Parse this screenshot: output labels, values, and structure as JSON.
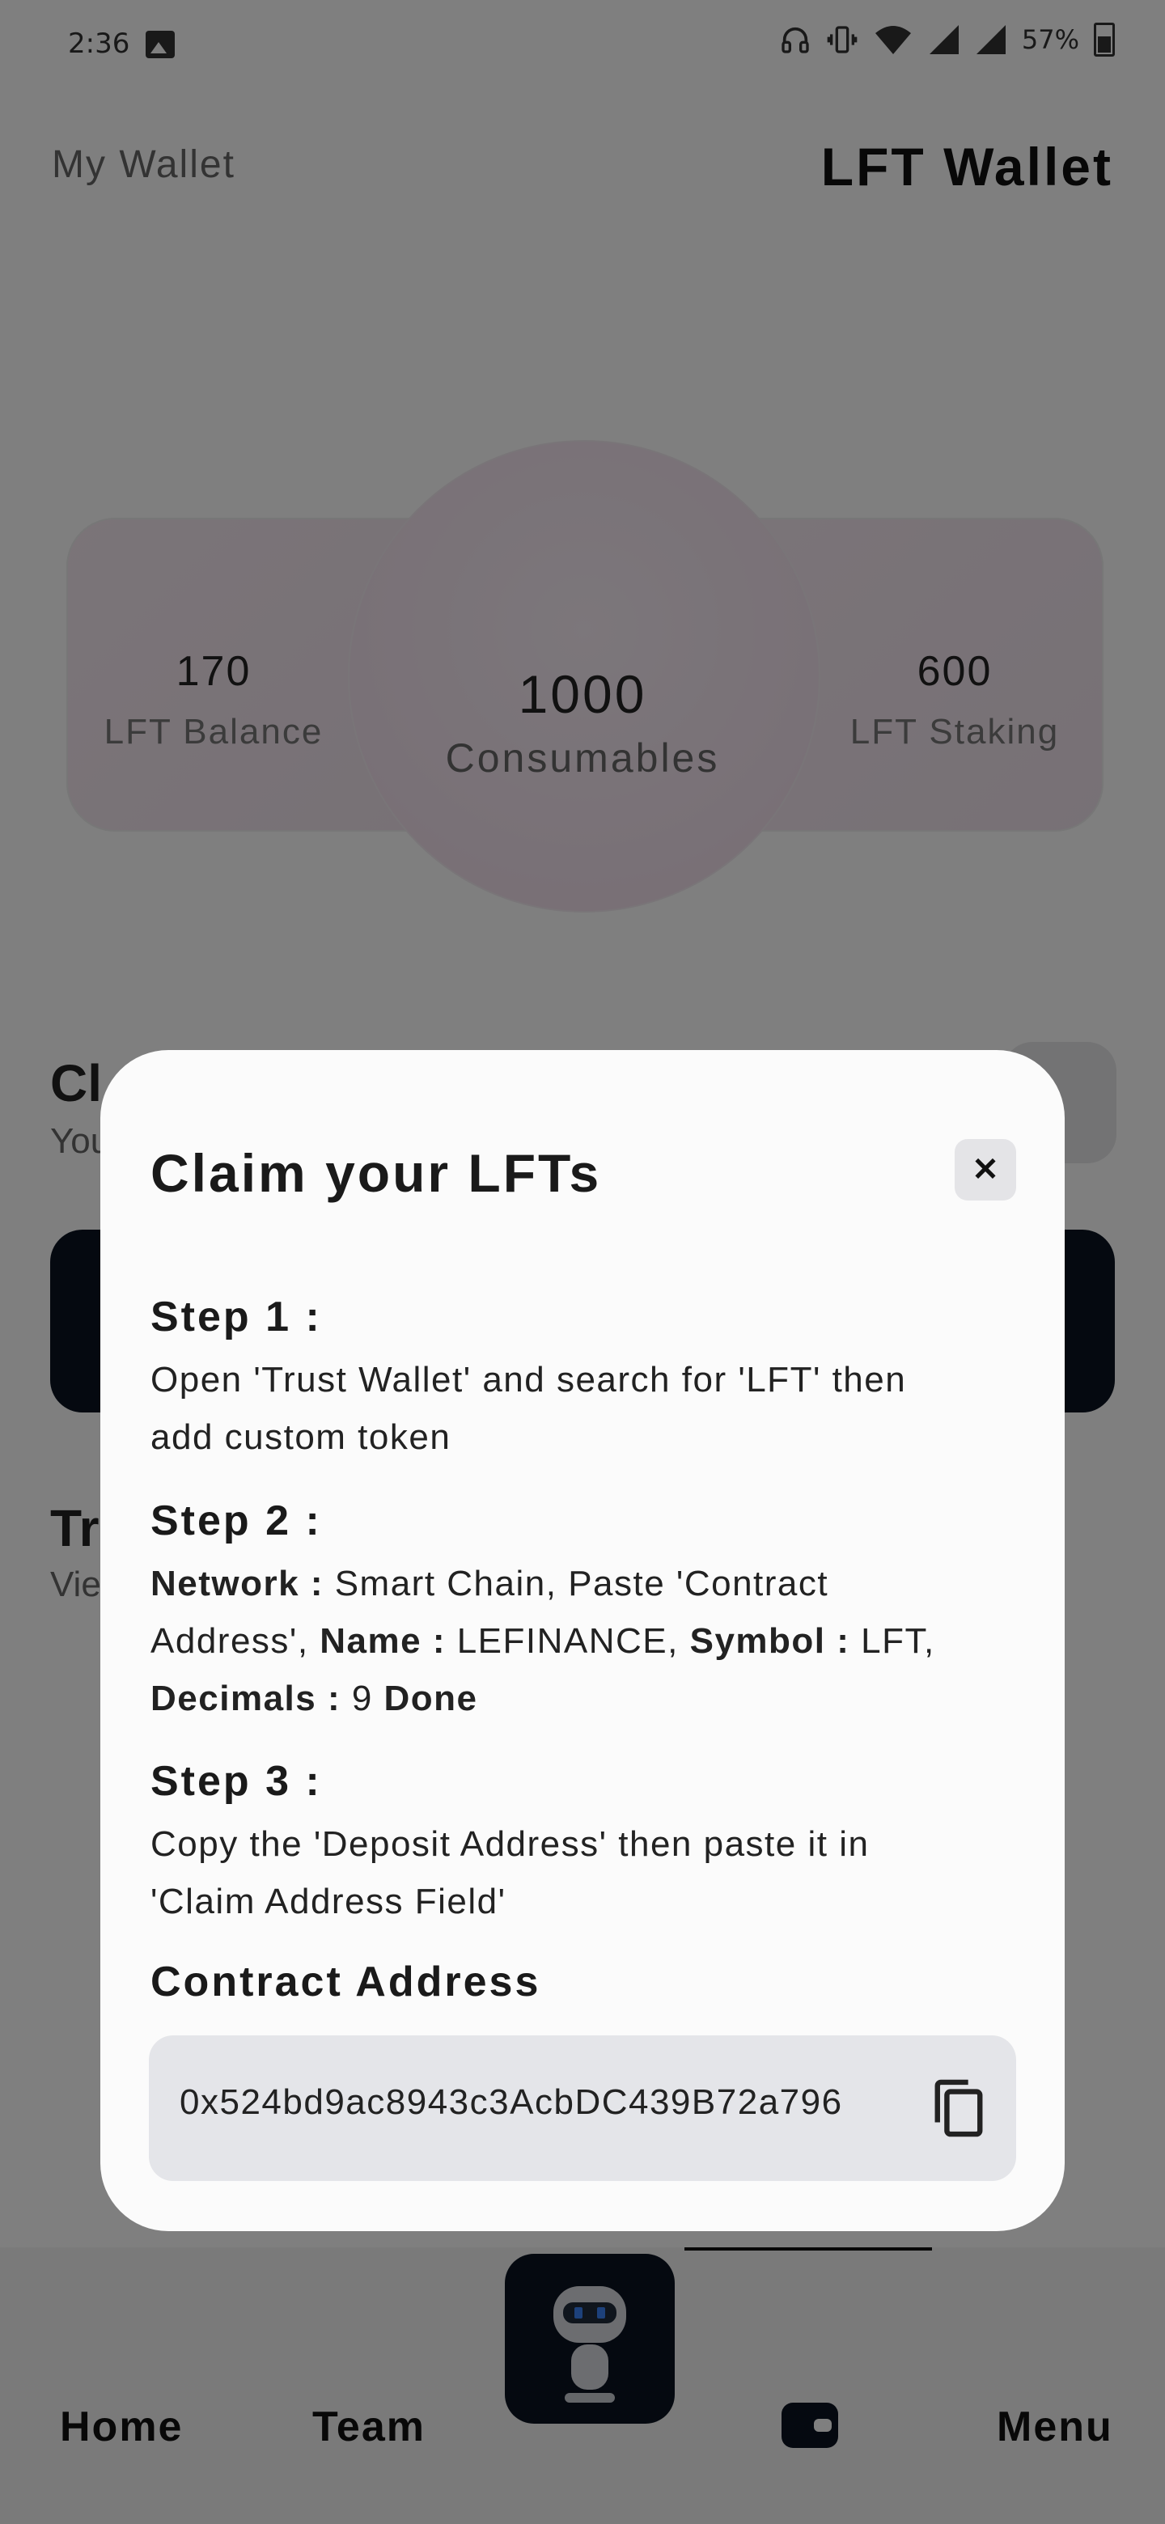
{
  "status_bar": {
    "time": "2:36",
    "battery": "57%",
    "icons": [
      "image-icon",
      "headphones-icon",
      "vibrate-icon",
      "wifi-icon",
      "signal-icon",
      "signal-icon",
      "battery-icon"
    ]
  },
  "header": {
    "left_title": "My Wallet",
    "right_title": "LFT Wallet"
  },
  "stats": {
    "balance_value": "170",
    "balance_label": "LFT Balance",
    "consumables_value": "1000",
    "consumables_label": "Consumables",
    "staking_value": "600",
    "staking_label": "LFT Staking"
  },
  "background_sections": {
    "claim_heading_partial": "Cl",
    "claim_sub_partial": "You",
    "transactions_heading_partial": "Tr",
    "transactions_sub_partial": "Vie"
  },
  "bottom_nav": {
    "home": "Home",
    "team": "Team",
    "menu": "Menu",
    "center_icon": "robot-icon",
    "wallet_icon": "wallet-icon"
  },
  "modal": {
    "title": "Claim your LFTs",
    "close_icon": "close-icon",
    "step1_heading": "Step 1 :",
    "step1_text": "Open 'Trust Wallet' and search for 'LFT' then add custom token",
    "step2_heading": "Step 2 :",
    "step2": {
      "network_label": "Network :",
      "network_text": " Smart Chain, Paste 'Contract Address', ",
      "name_label": "Name :",
      "name_text": " LEFINANCE, ",
      "symbol_label": "Symbol :",
      "symbol_text": " LFT, ",
      "decimals_label": "Decimals :",
      "decimals_text": " 9 ",
      "done_label": "Done"
    },
    "step3_heading": "Step 3 :",
    "step3_text": "Copy the 'Deposit Address' then paste it in 'Claim Address Field'",
    "contract_heading": "Contract Address",
    "contract_address": "0x524bd9ac8943c3AcbDC439B72a796",
    "copy_icon": "copy-icon"
  }
}
